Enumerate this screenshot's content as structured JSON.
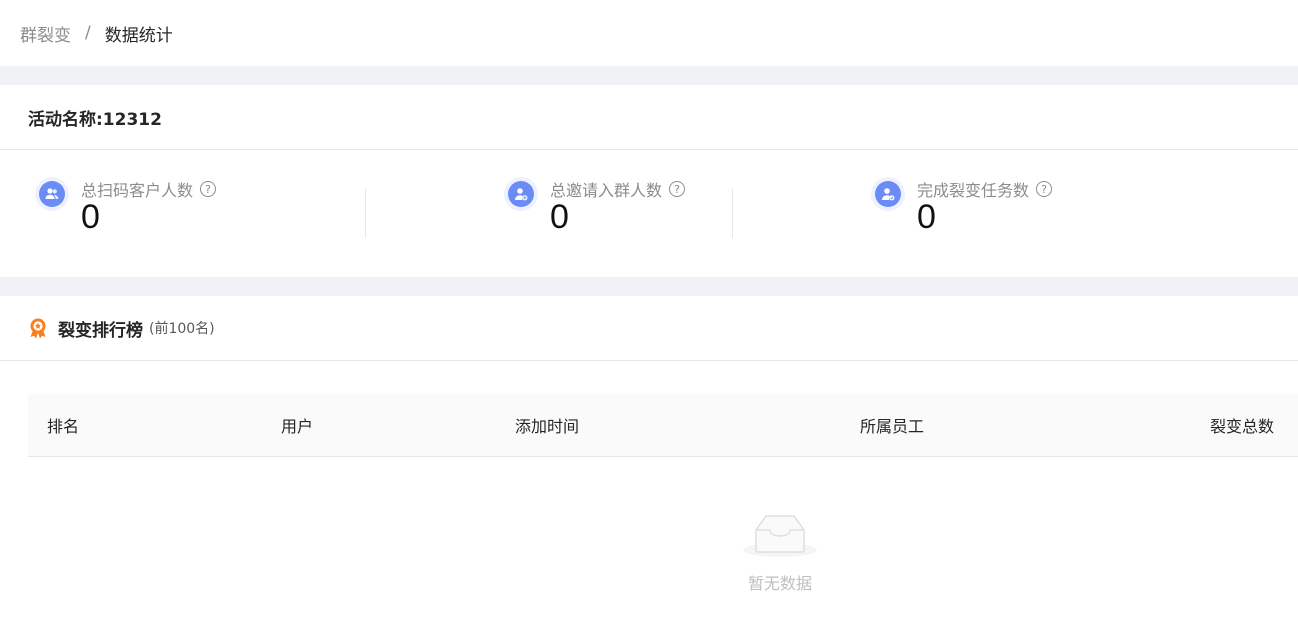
{
  "breadcrumb": {
    "parent": "群裂变",
    "separator": "/",
    "current": "数据统计"
  },
  "activity": {
    "title": "活动名称:12312"
  },
  "stats": [
    {
      "label": "总扫码客户人数",
      "value": "0",
      "icon": "users-icon"
    },
    {
      "label": "总邀请入群人数",
      "value": "0",
      "icon": "user-add-icon"
    },
    {
      "label": "完成裂变任务数",
      "value": "0",
      "icon": "user-check-icon"
    }
  ],
  "ranking": {
    "title": "裂变排行榜",
    "subtitle": "(前100名)",
    "icon": "medal-icon",
    "accent": "#fa7d1e",
    "columns": [
      "排名",
      "用户",
      "添加时间",
      "所属员工",
      "裂变总数"
    ],
    "empty_text": "暂无数据"
  }
}
